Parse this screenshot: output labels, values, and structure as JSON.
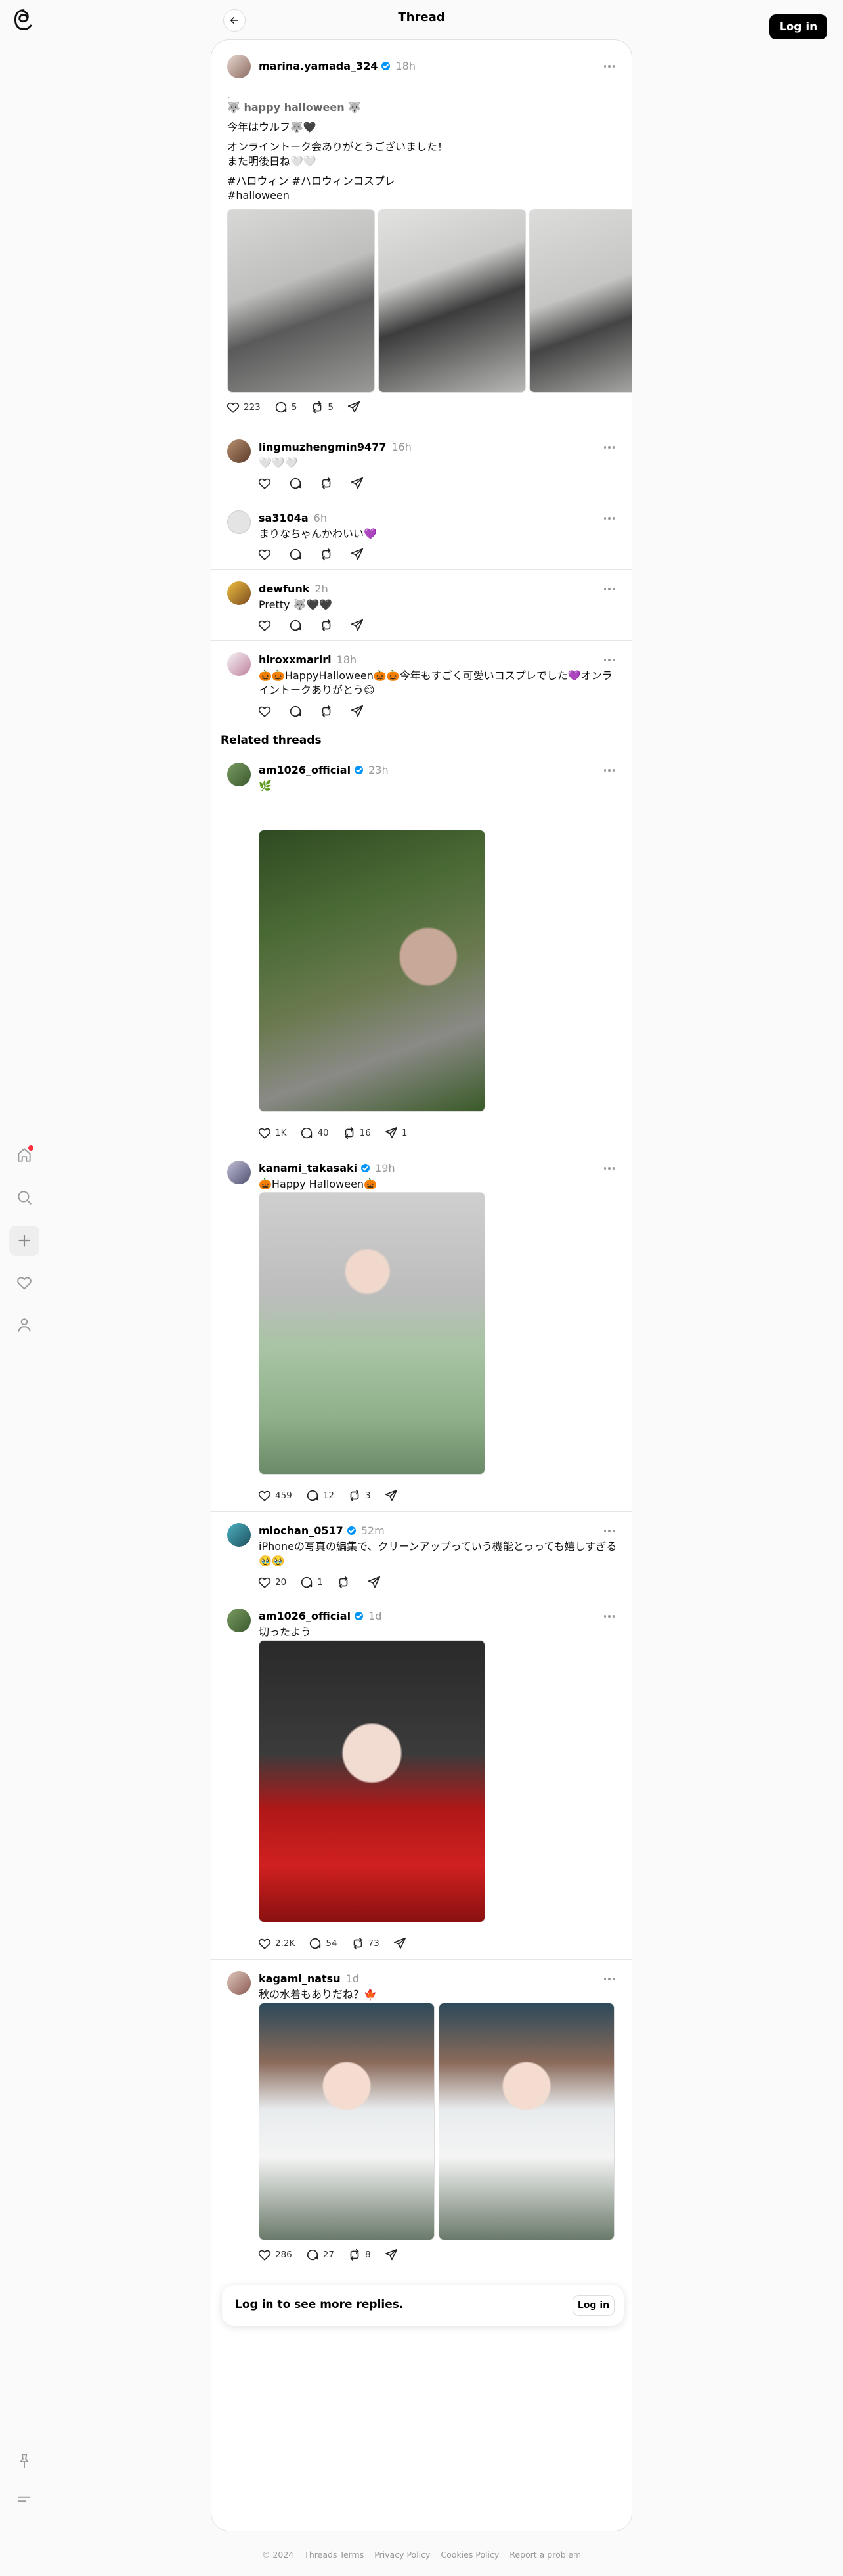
{
  "header": {
    "title": "Thread",
    "login_label": "Log in"
  },
  "main_post": {
    "username": "marina.yamada_324",
    "time": "18h",
    "lines": [
      "🐺 happy halloween 🐺",
      "今年はウルフ🐺🖤",
      "オンライントーク会ありがとうございました！",
      "また明後日ね🤍🤍",
      "#ハロウィン #ハロウィンコスプレ",
      "#halloween"
    ],
    "likes": "223",
    "replies": "5",
    "reposts": "5"
  },
  "replies": [
    {
      "username": "lingmuzhengmin9477",
      "time": "16h",
      "text": "🤍🤍🤍"
    },
    {
      "username": "sa3104a",
      "time": "6h",
      "text": "まりなちゃんかわいい💜"
    },
    {
      "username": "dewfunk",
      "time": "2h",
      "text": "Pretty 🐺🖤🖤"
    },
    {
      "username": "hiroxxmariri",
      "time": "18h",
      "text": "🎃🎃HappyHalloween🎃🎃今年もすごく可愛いコスプレでした💜オンライントークありがとう😊"
    }
  ],
  "related_title": "Related threads",
  "related": [
    {
      "username": "am1026_official",
      "time": "23h",
      "text": "🌿",
      "likes": "1K",
      "replies": "40",
      "reposts": "16",
      "shares": "1"
    },
    {
      "username": "kanami_takasaki",
      "time": "19h",
      "text": "🎃Happy Halloween🎃",
      "likes": "459",
      "replies": "12",
      "reposts": "3",
      "shares": ""
    },
    {
      "username": "miochan_0517",
      "time": "52m",
      "text": "iPhoneの写真の編集で、クリーンアップっていう機能とっっても嬉しすぎる🥹🥹",
      "likes": "20",
      "replies": "1",
      "reposts": "",
      "shares": ""
    },
    {
      "username": "am1026_official",
      "time": "1d",
      "text": "切ったよう",
      "likes": "2.2K",
      "replies": "54",
      "reposts": "73",
      "shares": ""
    },
    {
      "username": "kagami_natsu",
      "time": "1d",
      "text": "秋の水着もありだね？🍁",
      "likes": "286",
      "replies": "27",
      "reposts": "8",
      "shares": ""
    }
  ],
  "login_prompt": {
    "text": "Log in to see more replies.",
    "button": "Log in"
  },
  "footer": [
    "© 2024",
    "Threads Terms",
    "Privacy Policy",
    "Cookies Policy",
    "Report a problem"
  ],
  "icons": [
    "threads-logo-icon",
    "home-icon",
    "search-icon",
    "plus-icon",
    "heart-icon",
    "user-icon",
    "pin-icon",
    "menu-icon",
    "back-arrow-icon",
    "more-icon",
    "like-icon",
    "reply-icon",
    "repost-icon",
    "share-icon"
  ],
  "colors": {
    "verified": "#0095f6",
    "notification": "#ff3040",
    "login_button": "#000000"
  }
}
